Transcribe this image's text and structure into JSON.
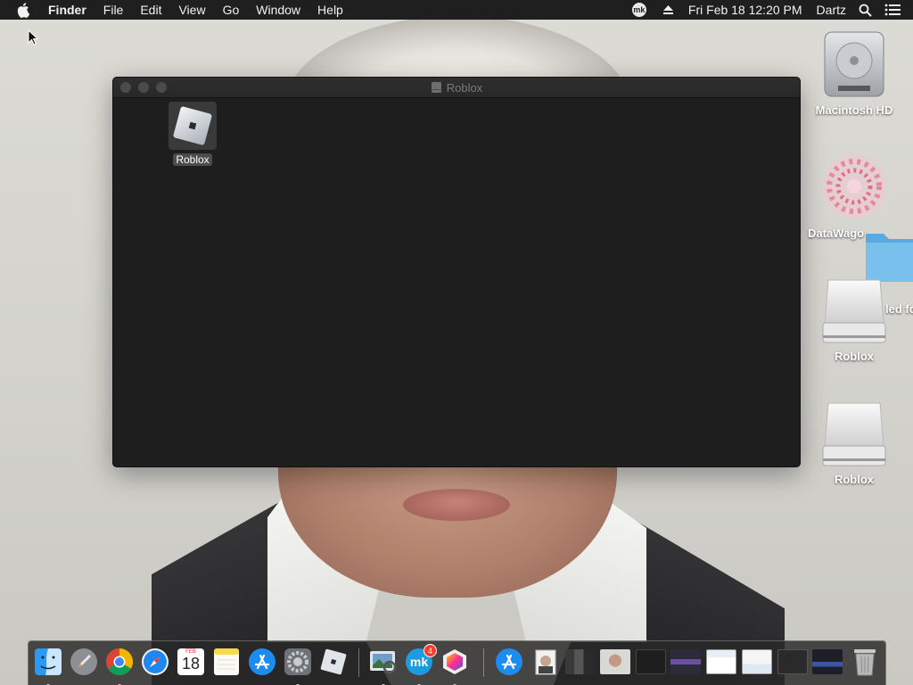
{
  "menubar": {
    "app_name": "Finder",
    "menus": [
      "File",
      "Edit",
      "View",
      "Go",
      "Window",
      "Help"
    ],
    "status_mk": "mk",
    "clock": "Fri Feb 18  12:20 PM",
    "user": "Dartz"
  },
  "window": {
    "title": "Roblox",
    "items": [
      {
        "label": "Roblox",
        "icon": "roblox-app-icon"
      }
    ]
  },
  "desktop": {
    "icons": [
      {
        "label": "Macintosh HD",
        "icon": "hard-drive-icon"
      },
      {
        "label": "DataWago",
        "icon": "datawago-icon"
      },
      {
        "label": "led fo",
        "icon": "folder-icon"
      },
      {
        "label": "Roblox",
        "icon": "disk-image-icon"
      },
      {
        "label": "Roblox",
        "icon": "disk-image-icon"
      }
    ]
  },
  "dock": {
    "calendar_month": "FEB",
    "calendar_day": "18",
    "mk_badge": "4",
    "items": [
      "finder",
      "launchpad",
      "chrome",
      "safari",
      "calendar",
      "notes",
      "app-store",
      "system-preferences",
      "roblox",
      "preview",
      "mk",
      "color-app",
      "app-store",
      "documents-stack",
      "window-thumbnails",
      "trash"
    ]
  },
  "colors": {
    "menubar_bg": "#1f1f1f",
    "window_bg": "#1e1e1e",
    "accent_blue": "#1e87f0"
  }
}
